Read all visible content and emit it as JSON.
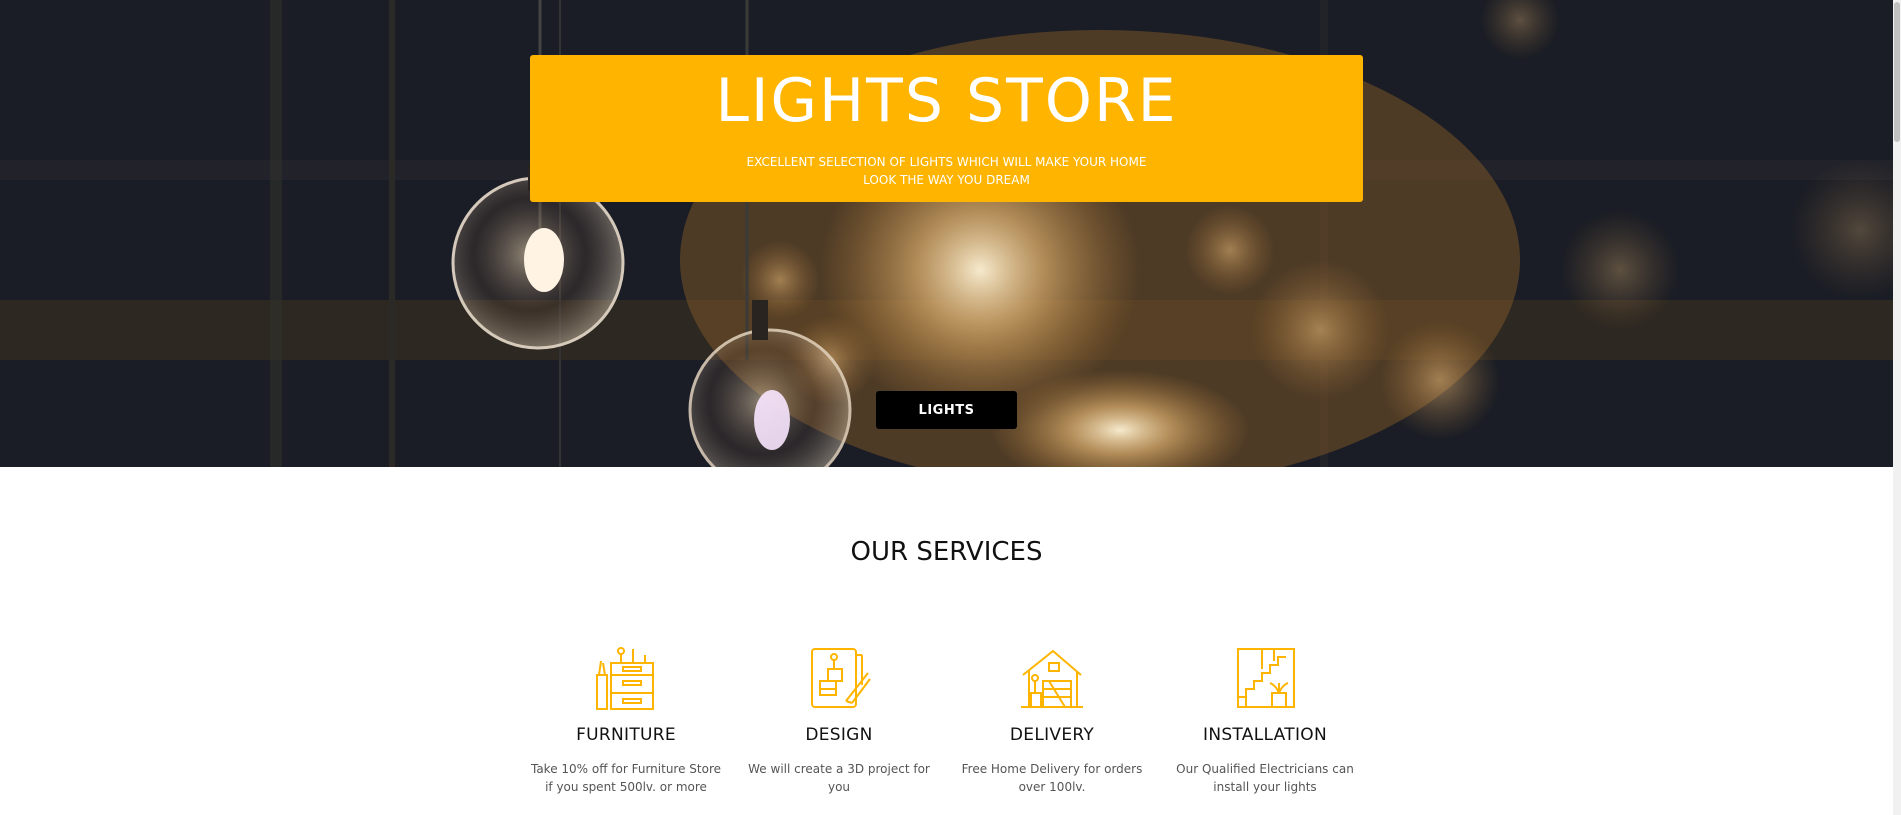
{
  "hero": {
    "title": "LIGHTS STORE",
    "subtitle": "EXCELLENT SELECTION OF LIGHTS WHICH WILL MAKE YOUR HOME LOOK THE WAY YOU DREAM",
    "button_label": "LIGHTS",
    "accent_color": "#ffb400",
    "button_color": "#000000"
  },
  "services": {
    "title": "OUR SERVICES",
    "icon_color": "#ffb400",
    "items": [
      {
        "icon": "furniture-icon",
        "title": "FURNITURE",
        "text": "Take 10% off for Furniture Store if you spent 500lv. or more"
      },
      {
        "icon": "design-icon",
        "title": "DESIGN",
        "text": "We will create a 3D project for you"
      },
      {
        "icon": "delivery-icon",
        "title": "DELIVERY",
        "text": "Free Home Delivery for orders over 100lv."
      },
      {
        "icon": "installation-icon",
        "title": "INSTALLATION",
        "text": "Our Qualified Electricians can install your lights"
      }
    ]
  }
}
